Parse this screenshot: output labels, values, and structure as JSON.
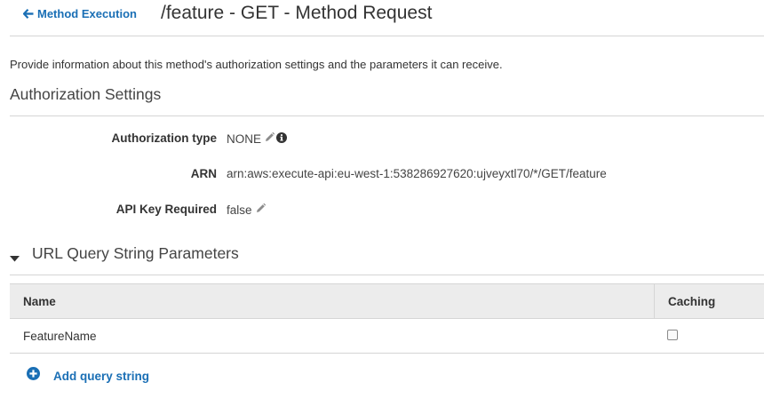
{
  "header": {
    "back_label": "Method Execution",
    "title": "/feature - GET - Method Request"
  },
  "description": "Provide information about this method's authorization settings and the parameters it can receive.",
  "authorization": {
    "section_title": "Authorization Settings",
    "rows": [
      {
        "label": "Authorization type",
        "value": "NONE"
      },
      {
        "label": "ARN",
        "value": "arn:aws:execute-api:eu-west-1:538286927620:ujveyxtl70/*/GET/feature"
      },
      {
        "label": "API Key Required",
        "value": "false"
      }
    ]
  },
  "query_params": {
    "section_title": "URL Query String Parameters",
    "expanded": true,
    "columns": {
      "name": "Name",
      "caching": "Caching"
    },
    "rows": [
      {
        "name": "FeatureName",
        "caching": false
      }
    ],
    "add_label": "Add query string"
  },
  "colors": {
    "link": "#1a6fb5",
    "header_bg": "#ececec",
    "border": "#d5d5d5"
  },
  "icons": {
    "back": "arrow-left-icon",
    "edit": "pencil-icon",
    "info": "info-circle-icon",
    "toggle": "caret-down-icon",
    "add": "plus-circle-icon"
  }
}
